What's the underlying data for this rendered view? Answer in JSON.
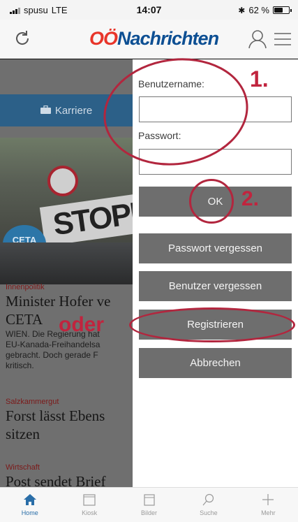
{
  "status_bar": {
    "carrier": "spusu",
    "network": "LTE",
    "time": "14:07",
    "battery": "62 %",
    "battery_level": 0.62
  },
  "header": {
    "logo_red": "OÖ",
    "logo_blue": "Nachrichten"
  },
  "background": {
    "career_button": "Karriere",
    "photo": {
      "sign_text": "STOPP",
      "badge_text": "CETA"
    },
    "articles": [
      {
        "category": "Innenpolitik",
        "headline": "Minister Hofer ve",
        "headline2": "CETA",
        "body": [
          "WIEN. Die Regierung hat",
          "EU-Kanada-Freihandelsa",
          "gebracht. Doch gerade F",
          "kritisch."
        ]
      },
      {
        "category": "Salzkammergut",
        "headline": "Forst lässt Ebens",
        "headline2": "sitzen"
      },
      {
        "category": "Wirtschaft",
        "headline": "Post sendet Brief"
      }
    ]
  },
  "login": {
    "username_label": "Benutzername:",
    "username_value": "",
    "password_label": "Passwort:",
    "password_value": "",
    "ok_label": "OK",
    "forgot_password_label": "Passwort vergessen",
    "forgot_user_label": "Benutzer vergessen",
    "register_label": "Registrieren",
    "cancel_label": "Abbrechen"
  },
  "annotations": {
    "step1": "1.",
    "step2": "2.",
    "or": "oder",
    "color": "#c1243e"
  },
  "tabbar": [
    {
      "label": "Home",
      "icon": "home-icon",
      "active": true
    },
    {
      "label": "Kiosk",
      "icon": "kiosk-icon",
      "active": false
    },
    {
      "label": "Bilder",
      "icon": "images-icon",
      "active": false
    },
    {
      "label": "Suche",
      "icon": "search-icon",
      "active": false
    },
    {
      "label": "Mehr",
      "icon": "plus-icon",
      "active": false
    }
  ],
  "colors": {
    "brand_blue": "#0d4f93",
    "brand_red": "#e8352a",
    "button_gray": "#6e6e6e",
    "career_blue": "#2c6088",
    "tab_active": "#2a6ea8"
  }
}
